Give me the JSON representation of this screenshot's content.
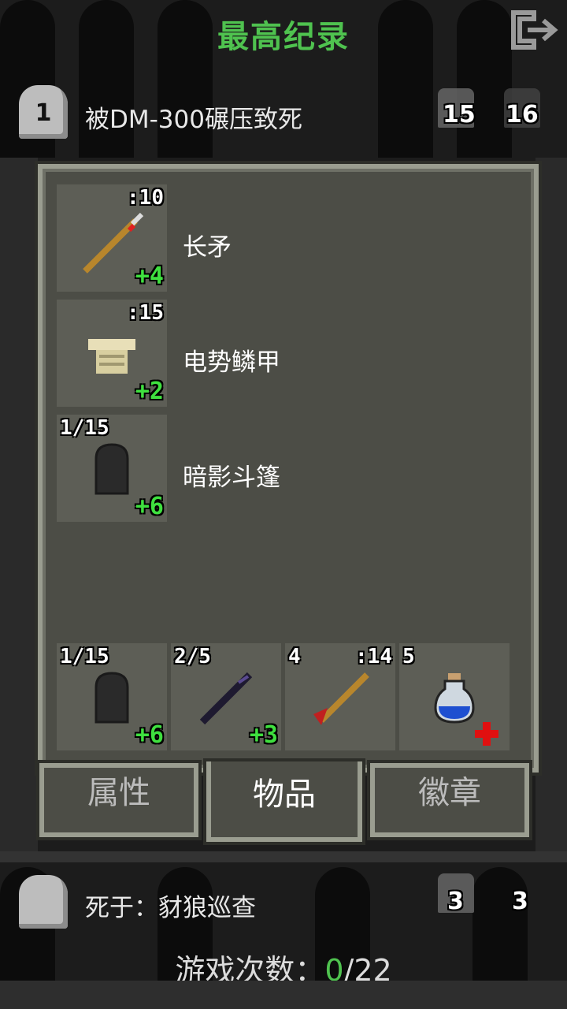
{
  "header": {
    "title": "最高纪录",
    "exit_icon": "exit-icon"
  },
  "top_record": {
    "rank": "1",
    "text": "被DM-300碾压致死",
    "stat_a": "15",
    "stat_b": "16"
  },
  "equipped": [
    {
      "name": "长矛",
      "label": ":10",
      "level": "+4",
      "icon": "spear-icon"
    },
    {
      "name": "电势鳞甲",
      "label": ":15",
      "level": "+2",
      "icon": "scale-armor-icon"
    },
    {
      "name": "暗影斗篷",
      "label": "1/15",
      "level": "+6",
      "icon": "cloak-icon"
    }
  ],
  "quickslots": [
    {
      "label": "1/15",
      "level": "+6",
      "icon": "cloak-icon"
    },
    {
      "label": "2/5",
      "level": "+3",
      "icon": "wand-icon"
    },
    {
      "label": "4",
      "label2": ":14",
      "level": "",
      "icon": "spear-icon"
    },
    {
      "label": "5",
      "level": "",
      "icon": "potion-icon"
    }
  ],
  "tabs": [
    {
      "label": "属性",
      "active": false
    },
    {
      "label": "物品",
      "active": true
    },
    {
      "label": "徽章",
      "active": false
    }
  ],
  "last_record": {
    "text": "死于：豺狼巡查",
    "stat_a": "3",
    "stat_b": "3"
  },
  "games": {
    "label": "游戏次数：",
    "current": "0",
    "total": "/22"
  },
  "colors": {
    "accent": "#4fc24f",
    "level": "#3fe03f",
    "panel": "#4c4d46",
    "border": "#9a9d90"
  }
}
